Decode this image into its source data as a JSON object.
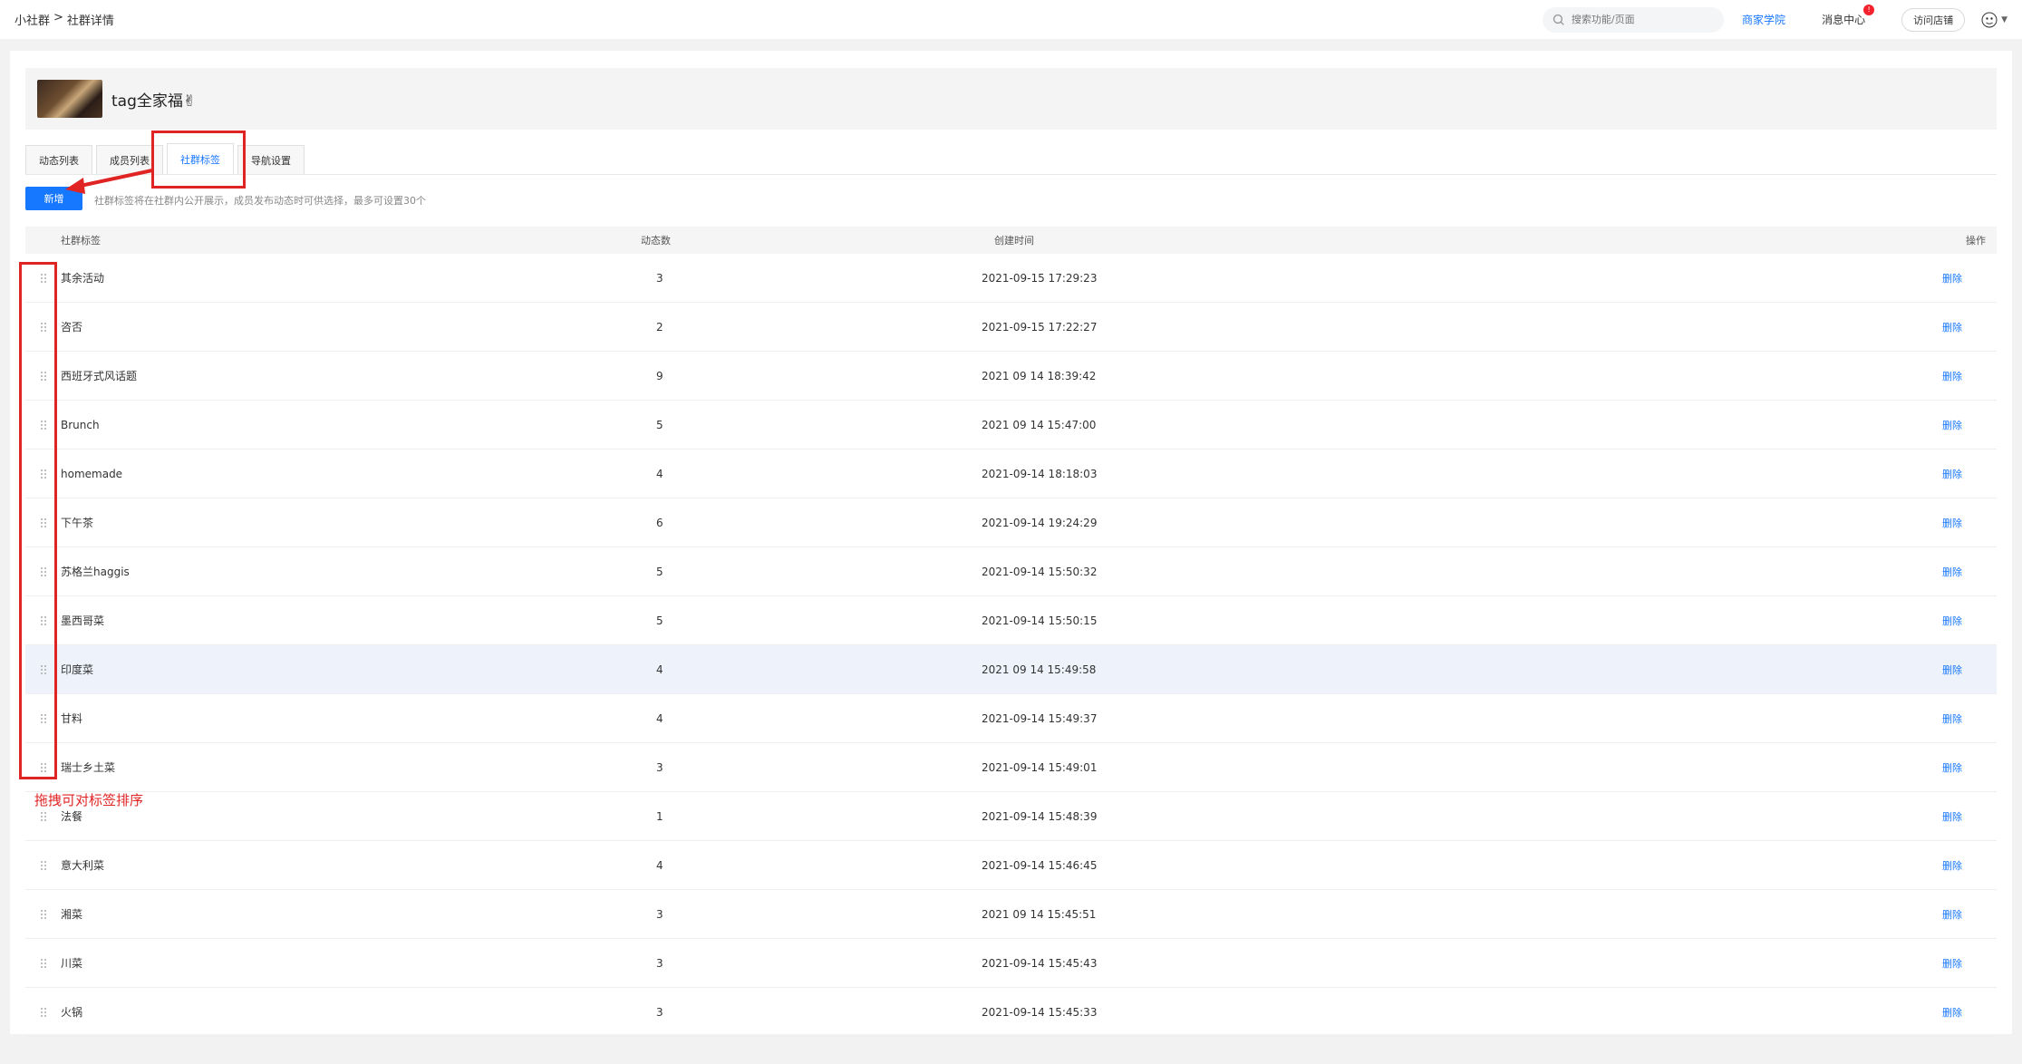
{
  "topbar": {
    "breadcrumb": [
      "小社群",
      ">",
      "社群详情"
    ],
    "search_placeholder": "搜索功能/页面",
    "merchant_college": "商家学院",
    "message_center": "消息中心",
    "message_badge": "!",
    "visit_store": "访问店铺"
  },
  "community": {
    "name": "tag全家福✌"
  },
  "tabs": [
    {
      "label": "动态列表"
    },
    {
      "label": "成员列表"
    },
    {
      "label": "社群标签"
    },
    {
      "label": "导航设置"
    }
  ],
  "toolbar": {
    "add_label": "新增",
    "hint": "社群标签将在社群内公开展示，成员发布动态时可供选择，最多可设置30个"
  },
  "table": {
    "headers": [
      "社群标签",
      "动态数",
      "创建时间",
      "操作"
    ],
    "delete_label": "删除",
    "rows": [
      {
        "tag": "其余活动",
        "count": "3",
        "time": "2021-09-15 17:29:23"
      },
      {
        "tag": "咨否",
        "count": "2",
        "time": "2021-09-15 17:22:27"
      },
      {
        "tag": "西班牙式风话题",
        "count": "9",
        "time": "2021 09 14 18:39:42"
      },
      {
        "tag": "Brunch",
        "count": "5",
        "time": "2021 09 14 15:47:00"
      },
      {
        "tag": "homemade",
        "count": "4",
        "time": "2021-09-14 18:18:03"
      },
      {
        "tag": "下午茶",
        "count": "6",
        "time": "2021-09-14 19:24:29"
      },
      {
        "tag": "苏格兰haggis",
        "count": "5",
        "time": "2021-09-14 15:50:32"
      },
      {
        "tag": "墨西哥菜",
        "count": "5",
        "time": "2021-09-14 15:50:15"
      },
      {
        "tag": "印度菜",
        "count": "4",
        "time": "2021 09 14 15:49:58"
      },
      {
        "tag": "甘料",
        "count": "4",
        "time": "2021-09-14 15:49:37"
      },
      {
        "tag": "瑞士乡土菜",
        "count": "3",
        "time": "2021-09-14 15:49:01"
      },
      {
        "tag": "法餐",
        "count": "1",
        "time": "2021-09-14 15:48:39"
      },
      {
        "tag": "意大利菜",
        "count": "4",
        "time": "2021-09-14 15:46:45"
      },
      {
        "tag": "湘菜",
        "count": "3",
        "time": "2021 09 14 15:45:51"
      },
      {
        "tag": "川菜",
        "count": "3",
        "time": "2021-09-14 15:45:43"
      },
      {
        "tag": "火锅",
        "count": "3",
        "time": "2021-09-14 15:45:33"
      }
    ]
  },
  "annotation": {
    "text": "拖拽可对标签排序"
  },
  "colors": {
    "accent": "#1677ff",
    "annotation": "#e02424",
    "highlight_row": "#eef3fb"
  }
}
